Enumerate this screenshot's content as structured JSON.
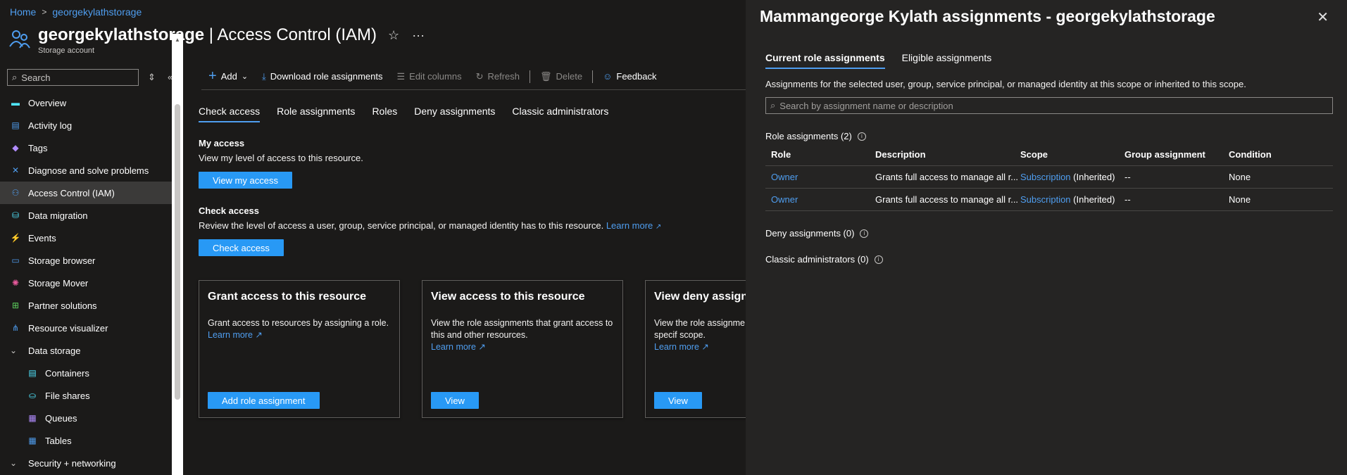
{
  "breadcrumb": [
    "Home",
    "georgekylathstorage"
  ],
  "header": {
    "resource_name": "georgekylathstorage",
    "page_name": "Access Control (IAM)",
    "separator": "|",
    "subtitle": "Storage account",
    "star_icon": "star-icon",
    "more_icon": "more-icon"
  },
  "sidebar": {
    "search_placeholder": "Search",
    "items": [
      {
        "label": "Overview",
        "icon": "overview-icon",
        "color": "#50e6ff"
      },
      {
        "label": "Activity log",
        "icon": "activity-log-icon",
        "color": "#4f9ef0"
      },
      {
        "label": "Tags",
        "icon": "tag-icon",
        "color": "#b18cff"
      },
      {
        "label": "Diagnose and solve problems",
        "icon": "wrench-icon",
        "color": "#4f9ef0"
      },
      {
        "label": "Access Control (IAM)",
        "icon": "people-icon",
        "color": "#4f9ef0"
      },
      {
        "label": "Data migration",
        "icon": "migration-icon",
        "color": "#50e6ff"
      },
      {
        "label": "Events",
        "icon": "lightning-icon",
        "color": "#ffd02b"
      },
      {
        "label": "Storage browser",
        "icon": "storage-browser-icon",
        "color": "#4f9ef0"
      },
      {
        "label": "Storage Mover",
        "icon": "storage-mover-icon",
        "color": "#e85a9c"
      },
      {
        "label": "Partner solutions",
        "icon": "partner-icon",
        "color": "#5fd35f"
      },
      {
        "label": "Resource visualizer",
        "icon": "visualizer-icon",
        "color": "#4f9ef0"
      },
      {
        "label": "Data storage",
        "icon": "chevron-down-icon",
        "group": true
      },
      {
        "label": "Containers",
        "icon": "containers-icon",
        "color": "#50e6ff",
        "sub": true
      },
      {
        "label": "File shares",
        "icon": "file-shares-icon",
        "color": "#50e6ff",
        "sub": true
      },
      {
        "label": "Queues",
        "icon": "queues-icon",
        "color": "#b18cff",
        "sub": true
      },
      {
        "label": "Tables",
        "icon": "tables-icon",
        "color": "#4f9ef0",
        "sub": true
      },
      {
        "label": "Security + networking",
        "icon": "chevron-down-icon",
        "group": true
      }
    ]
  },
  "toolbar": {
    "add": "Add",
    "download": "Download role assignments",
    "edit_columns": "Edit columns",
    "refresh": "Refresh",
    "delete": "Delete",
    "feedback": "Feedback"
  },
  "tabs": [
    "Check access",
    "Role assignments",
    "Roles",
    "Deny assignments",
    "Classic administrators"
  ],
  "my_access": {
    "heading": "My access",
    "text": "View my level of access to this resource.",
    "button": "View my access"
  },
  "check_access": {
    "heading": "Check access",
    "text": "Review the level of access a user, group, service principal, or managed identity has to this resource.",
    "link": "Learn more",
    "button": "Check access"
  },
  "cards": [
    {
      "title": "Grant access to this resource",
      "desc": "Grant access to resources by assigning a role.",
      "link": "Learn more",
      "button": "Add role assignment"
    },
    {
      "title": "View access to this resource",
      "desc": "View the role assignments that grant access to this and other resources.",
      "link": "Learn more",
      "button": "View"
    },
    {
      "title": "View deny assignm",
      "desc": "View the role assignme denied access to specif scope.",
      "link": "Learn more",
      "button": "View"
    }
  ],
  "panel": {
    "title": "Mammangeorge Kylath assignments - georgekylathstorage",
    "tabs": [
      "Current role assignments",
      "Eligible assignments"
    ],
    "description": "Assignments for the selected user, group, service principal, or managed identity at this scope or inherited to this scope.",
    "search_placeholder": "Search by assignment name or description",
    "role_assignments_label": "Role assignments (2)",
    "columns": [
      "Role",
      "Description",
      "Scope",
      "Group assignment",
      "Condition"
    ],
    "rows": [
      {
        "role": "Owner",
        "description": "Grants full access to manage all r...",
        "scope": "Subscription",
        "scope_suffix": "(Inherited)",
        "group": "--",
        "condition": "None"
      },
      {
        "role": "Owner",
        "description": "Grants full access to manage all r...",
        "scope": "Subscription",
        "scope_suffix": "(Inherited)",
        "group": "--",
        "condition": "None"
      }
    ],
    "deny_label": "Deny assignments (0)",
    "classic_label": "Classic administrators (0)"
  },
  "colors": {
    "accent": "#2899f5",
    "link": "#4f9ef0",
    "background": "#1b1a19",
    "panel": "#252423"
  }
}
